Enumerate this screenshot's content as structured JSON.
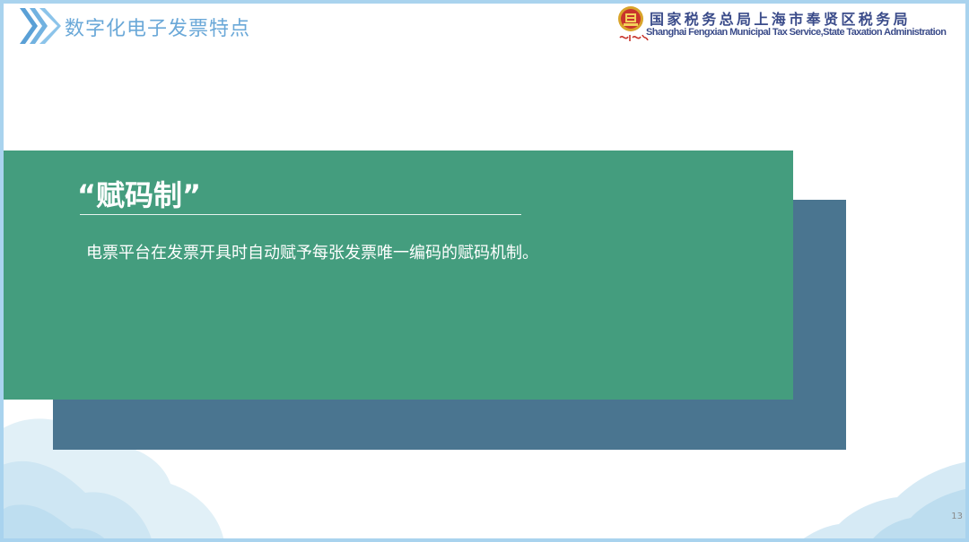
{
  "header": {
    "title": "数字化电子发票特点"
  },
  "organization": {
    "name_zh": "国家税务总局上海市奉贤区税务局",
    "name_en": "Shanghai Fengxian Municipal Tax Service,State Taxation  Administration",
    "motto": "中国税务"
  },
  "card": {
    "title": "“赋码制”",
    "body": "电票平台在发票开具时自动赋予每张发票唯一编码的赋码机制。"
  },
  "footer": {
    "page_number": "13"
  },
  "colors": {
    "header_title": "#6aa8d8",
    "front_box": "#449d7e",
    "back_box": "#4a7590",
    "org_text": "#3b4c8a",
    "frame": "#a9d3ee"
  },
  "icons": {
    "header": "triple-chevron-right-icon",
    "emblem": "tax-emblem-icon"
  }
}
